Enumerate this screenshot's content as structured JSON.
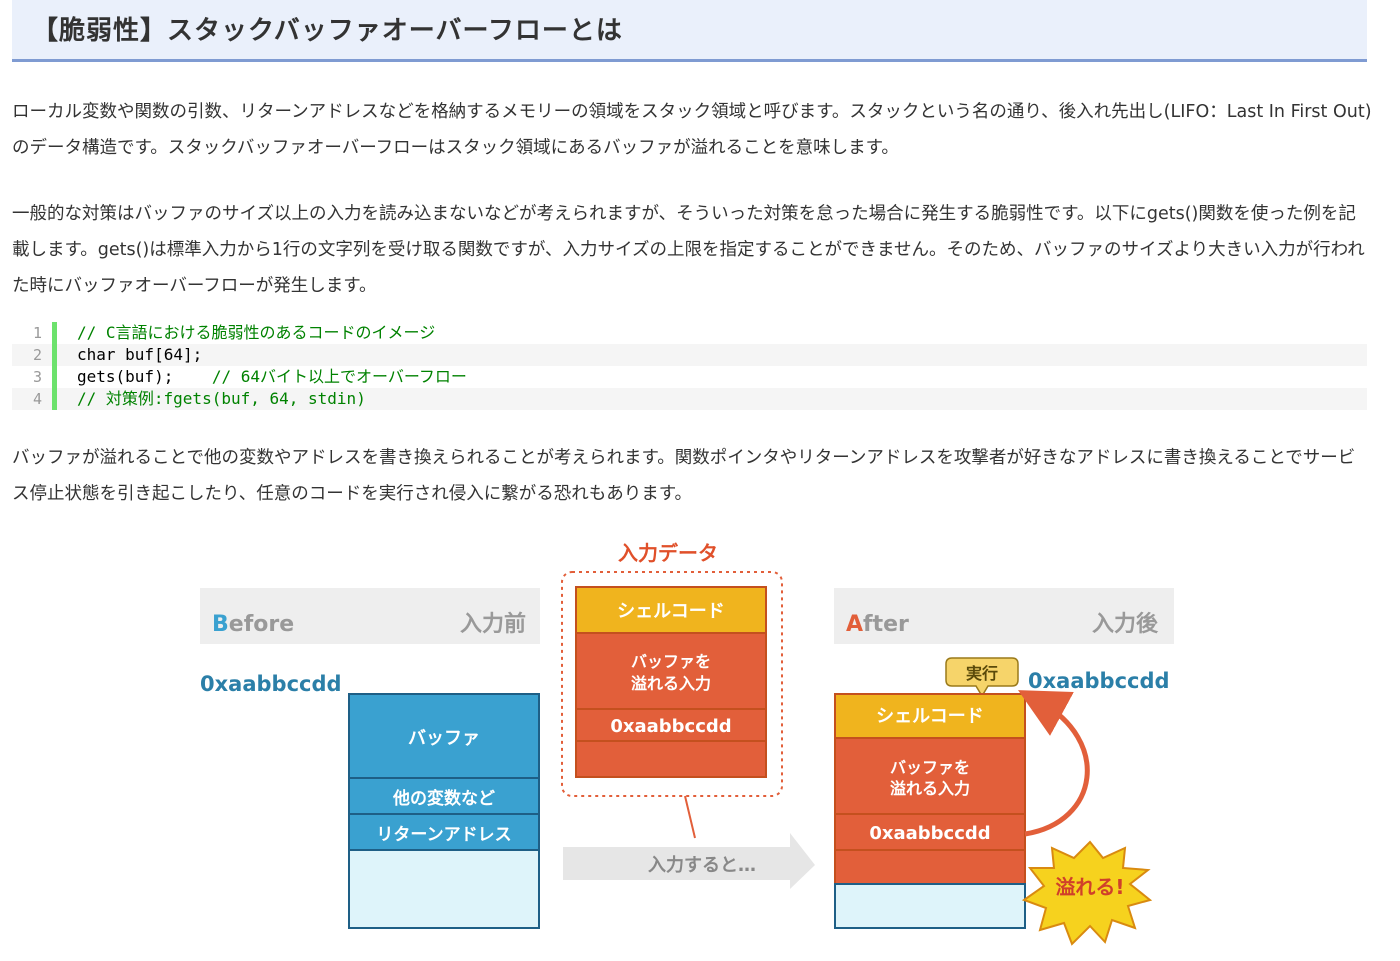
{
  "heading": "【脆弱性】スタックバッファオーバーフローとは",
  "paragraph1": "ローカル変数や関数の引数、リターンアドレスなどを格納するメモリーの領域をスタック領域と呼びます。スタックという名の通り、後入れ先出し(LIFO：Last In First Out)のデータ構造です。スタックバッファオーバーフローはスタック領域にあるバッファが溢れることを意味します。",
  "paragraph2": "一般的な対策はバッファのサイズ以上の入力を読み込まないなどが考えられますが、そういった対策を怠った場合に発生する脆弱性です。以下にgets()関数を使った例を記載します。gets()は標準入力から1行の文字列を受け取る関数ですが、入力サイズの上限を指定することができません。そのため、バッファのサイズより大きい入力が行われた時にバッファオーバーフローが発生します。",
  "code": {
    "line_numbers": [
      "1",
      "2",
      "3",
      "4"
    ],
    "line1_comment": "// C言語における脆弱性のあるコードのイメージ",
    "line2": "char buf[64];",
    "line3_code": "gets(buf);    ",
    "line3_comment": "// 64バイト以上でオーバーフロー",
    "line4_comment": "// 対策例:fgets(buf, 64, stdin)"
  },
  "paragraph3": "バッファが溢れることで他の変数やアドレスを書き換えられることが考えられます。関数ポインタやリターンアドレスを攻撃者が好きなアドレスに書き換えることでサービス停止状態を引き起こしたり、任意のコードを実行され侵入に繋がる恐れもあります。",
  "figure": {
    "before": {
      "title_initial": "B",
      "title_rest": "efore",
      "subtitle": "入力前",
      "address": "0xaabbccdd",
      "buffer": "バッファ",
      "other_vars": "他の変数など",
      "return_address": "リターンアドレス"
    },
    "input": {
      "title": "入力データ",
      "shellcode": "シェルコード",
      "overflow_line1": "バッファを",
      "overflow_line2": "溢れる入力",
      "address": "0xaabbccdd",
      "arrow_label": "入力すると…"
    },
    "after": {
      "title_initial": "A",
      "title_rest": "fter",
      "subtitle": "入力後",
      "address": "0xaabbccdd",
      "execute_badge": "実行",
      "shellcode": "シェルコード",
      "overflow_line1": "バッファを",
      "overflow_line2": "溢れる入力",
      "address_cell": "0xaabbccdd",
      "burst_label": "溢れる!"
    },
    "colors": {
      "accent_blue": "#3aa1d0",
      "yellow": "#f0b41e",
      "orange": "#e25f3a",
      "address_blue": "#2b7fa8",
      "red_title": "#e0502a"
    }
  }
}
